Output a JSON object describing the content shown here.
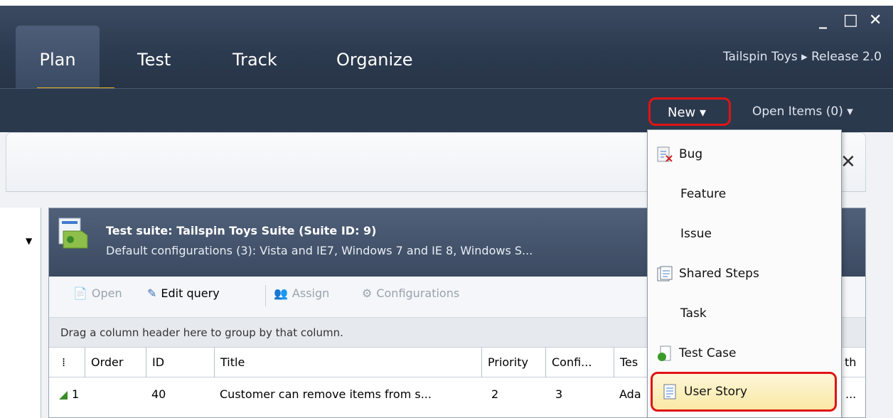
{
  "window": {
    "controls": {
      "minimize": "_",
      "maximize": "□",
      "close": "✕"
    }
  },
  "tabs": [
    {
      "label": "Plan",
      "active": true
    },
    {
      "label": "Test"
    },
    {
      "label": "Track"
    },
    {
      "label": "Organize"
    }
  ],
  "breadcrumb": "Tailspin Toys ▸ Release 2.0",
  "subbar": {
    "new_label": "New ▾",
    "open_items_label": "Open Items (0) ▾"
  },
  "new_menu": {
    "items": [
      {
        "label": "Bug",
        "icon": "bug-icon"
      },
      {
        "label": "Feature"
      },
      {
        "label": "Issue"
      },
      {
        "label": "Shared Steps",
        "icon": "shared-steps-icon"
      },
      {
        "label": "Task"
      },
      {
        "label": "Test Case",
        "icon": "test-case-icon"
      },
      {
        "label": "User Story",
        "icon": "user-story-icon",
        "selected": true
      }
    ]
  },
  "suite": {
    "title": "Test suite:  Tailspin Toys Suite (Suite ID: 9)",
    "config": "Default configurations (3):   Vista and IE7, Windows 7 and IE 8, Windows S..."
  },
  "toolbar": {
    "open": "Open",
    "edit_query": "Edit query",
    "assign": "Assign",
    "configurations": "Configurations"
  },
  "grid": {
    "group_hint": "Drag a column header here to group by that column.",
    "columns": [
      "Order",
      "ID",
      "Title",
      "Priority",
      "Confi...",
      "Tes",
      "th"
    ],
    "rows": [
      {
        "order": "1",
        "id": "40",
        "title": "Customer can remove items from s...",
        "priority": "2",
        "config": "3",
        "tester": "Ada",
        "path": "..."
      }
    ]
  },
  "colors": {
    "header_bg": "#2c3a4f",
    "accent_underline": "#e6b422",
    "highlight_border": "#e01414",
    "menu_selected": "#f9e9a5"
  }
}
